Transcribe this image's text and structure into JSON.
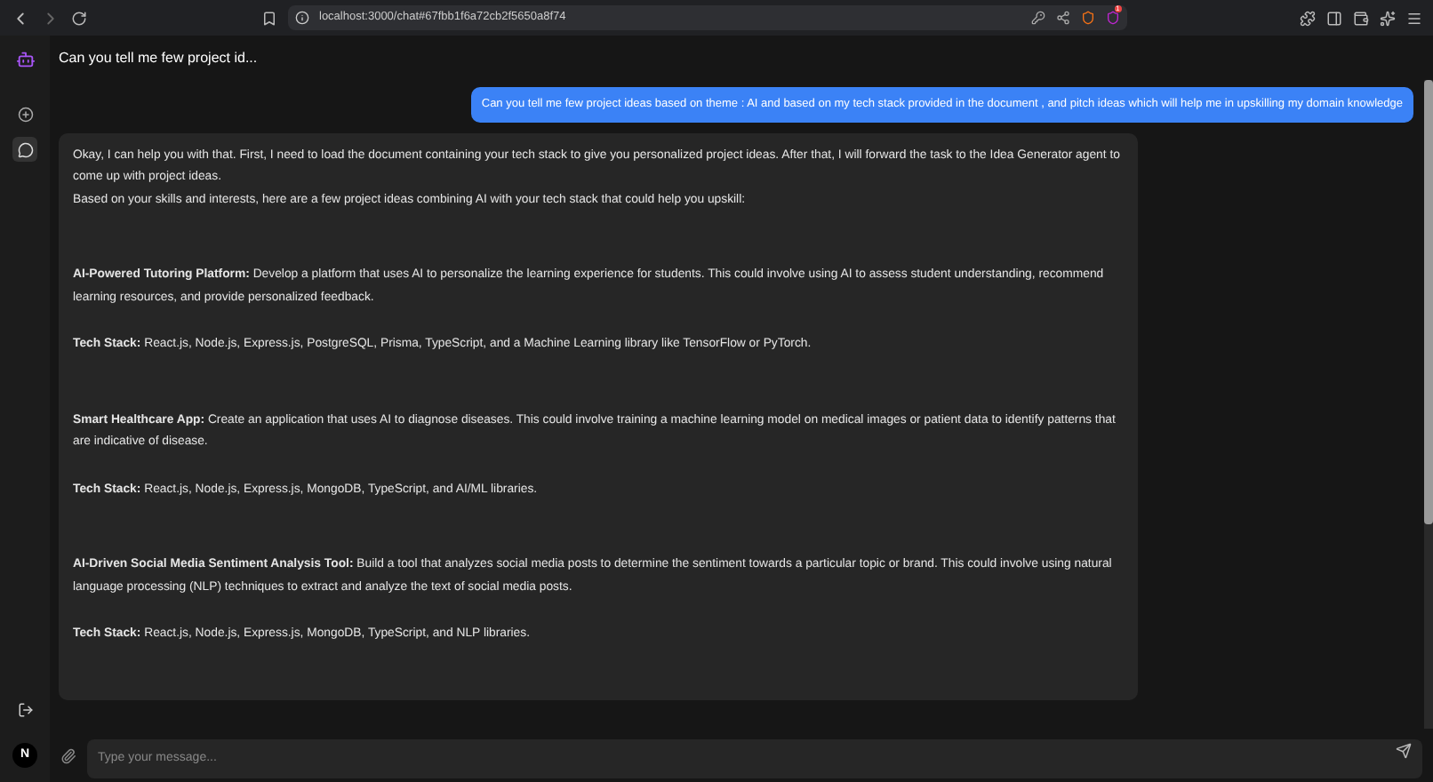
{
  "browser": {
    "url": "localhost:3000/chat#67fbb1f6a72cb2f5650a8f74",
    "notification_count": "1"
  },
  "header": {
    "title": "Can you tell me few project id..."
  },
  "messages": [
    {
      "kind": "user",
      "text": "Can you tell me few project ideas based on theme : AI and based on my tech stack provided in the document , and pitch ideas which will help me in upskilling my domain knowledge"
    },
    {
      "kind": "assistant",
      "paragraphs": [
        {
          "kind": "intro",
          "text": "Okay, I can help you with that. First, I need to load the document containing your tech stack to give you personalized project ideas. After that, I will forward the task to the Idea Generator agent to come up with project ideas."
        },
        {
          "kind": "line",
          "text": "Based on your skills and interests, here are a few project ideas combining AI with your tech stack that could help you upskill:"
        },
        {
          "kind": "idea",
          "text": "**AI-Powered Tutoring Platform:** Develop a platform that uses AI to personalize the learning experience for students. This could involve using AI to assess student understanding, recommend learning resources, and provide personalized feedback."
        },
        {
          "kind": "stack",
          "text": "**Tech Stack:** React.js, Node.js, Express.js, PostgreSQL, Prisma, TypeScript, and a Machine Learning library like TensorFlow or PyTorch."
        },
        {
          "kind": "idea",
          "text": "**Smart Healthcare App:** Create an application that uses AI to diagnose diseases. This could involve training a machine learning model on medical images or patient data to identify patterns that are indicative of disease."
        },
        {
          "kind": "stack",
          "text": "**Tech Stack:** React.js, Node.js, Express.js, MongoDB, TypeScript, and AI/ML libraries."
        },
        {
          "kind": "idea",
          "text": "**AI-Driven Social Media Sentiment Analysis Tool:** Build a tool that analyzes social media posts to determine the sentiment towards a particular topic or brand. This could involve using natural language processing (NLP) techniques to extract and analyze the text of social media posts."
        },
        {
          "kind": "stack",
          "text": "**Tech Stack:** React.js, Node.js, Express.js, MongoDB, TypeScript, and NLP libraries."
        }
      ]
    }
  ],
  "sidebar": {
    "items": [
      {
        "kind": "new",
        "selected": false
      },
      {
        "kind": "chat",
        "selected": true
      }
    ],
    "avatar": "N"
  },
  "composer": {
    "placeholder": "Type your message..."
  }
}
